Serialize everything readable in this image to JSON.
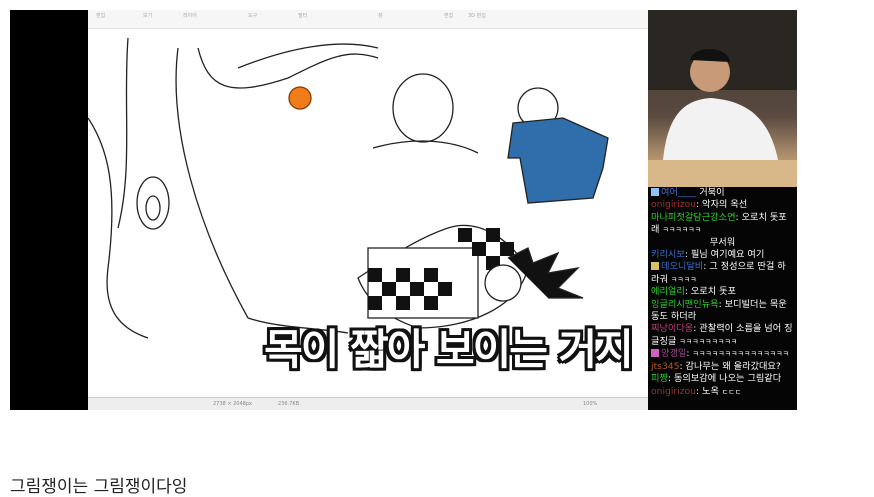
{
  "toolbar": {
    "items": [
      "편집",
      "보기",
      "레이어",
      "도구",
      "필터",
      "창"
    ],
    "right": [
      "편집",
      "3D 편집"
    ]
  },
  "statusbar": {
    "canvas_size": "2738 × 2048px",
    "file_size": "236.7KB",
    "zoom": "100%"
  },
  "subtitle": "목이 짧아 보이는 거지",
  "chat": [
    {
      "user": "여어____",
      "text": "거북이",
      "color": "#4a6fd8",
      "badge": "#8fc1ff"
    },
    {
      "user": "onigirizou",
      "text": "악자의 옥선",
      "color": "#7a2222"
    },
    {
      "user": "마나피젓갈담근강소연",
      "text": "오로치 돗포래",
      "tail": "ㅋㅋㅋㅋㅋㅋ",
      "color": "#2fd12f"
    },
    {
      "user": "",
      "text": "무서워",
      "color": "#fff"
    },
    {
      "user": "키리시보",
      "text": "필님 여기예요 여기",
      "color": "#3a6fd0"
    },
    {
      "user": "데오니달비",
      "text": "그 정성으로 딴걸 하라궈",
      "tail": "ㅋㅋㅋㅋ",
      "color": "#3a6fd0",
      "badge": "#d9c060"
    },
    {
      "user": "에리얼리",
      "text": "오로치 돗포",
      "color": "#2fd12f"
    },
    {
      "user": "잉글리시맨인뉴욕",
      "text": "보디빌더는 목운동도 하더라",
      "color": "#2fd12f"
    },
    {
      "user": "찌낭이다옹",
      "text": "관찰력이 소름을 넘어 징글징글",
      "tail": "ㅋㅋㅋㅋㅋㅋㅋㅋㅋ",
      "color": "#c0407a"
    },
    {
      "user": "양갱일",
      "text": "",
      "tail": "ㅋㅋㅋㅋㅋㅋㅋㅋㅋㅋㅋㅋㅋㅋㅋ",
      "color": "#a04a90",
      "badge": "#d060c0"
    },
    {
      "user": "jts345",
      "text": "감나무는 왜 올라갔대요?",
      "color": "#b05a20"
    },
    {
      "user": "피쨩",
      "text": "동의보감에 나오는 그림같다",
      "color": "#2fd12f"
    },
    {
      "user": "onigirizou",
      "text": "노옥",
      "tail": "ㄷㄷㄷ",
      "color": "#7a2222"
    }
  ],
  "caption": "그림쟁이는 그림쟁이다잉"
}
